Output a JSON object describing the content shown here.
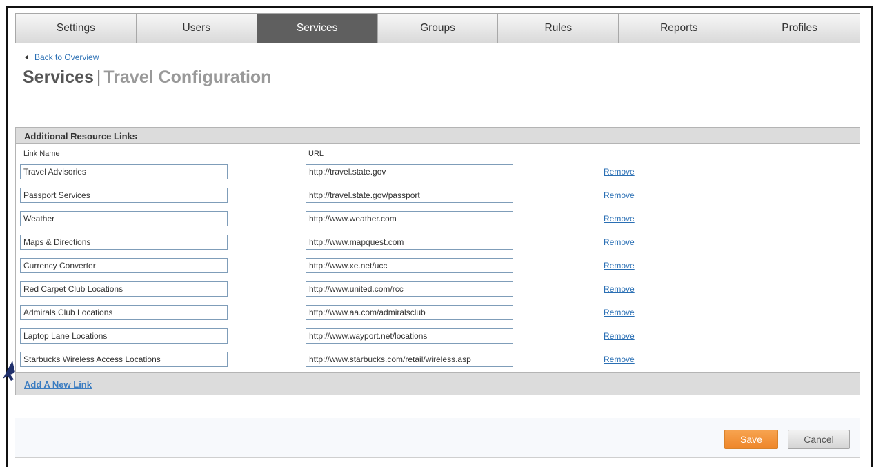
{
  "tabs": [
    {
      "label": "Settings",
      "active": false
    },
    {
      "label": "Users",
      "active": false
    },
    {
      "label": "Services",
      "active": true
    },
    {
      "label": "Groups",
      "active": false
    },
    {
      "label": "Rules",
      "active": false
    },
    {
      "label": "Reports",
      "active": false
    },
    {
      "label": "Profiles",
      "active": false
    }
  ],
  "back_link": "Back to Overview",
  "title": {
    "main": "Services",
    "separator": "|",
    "sub": "Travel Configuration"
  },
  "panel": {
    "title": "Additional Resource Links",
    "col_link_name": "Link Name",
    "col_url": "URL",
    "remove_label": "Remove",
    "add_link_label": "Add A New Link",
    "rows": [
      {
        "name": "Travel Advisories",
        "url": "http://travel.state.gov"
      },
      {
        "name": "Passport Services",
        "url": "http://travel.state.gov/passport"
      },
      {
        "name": "Weather",
        "url": "http://www.weather.com"
      },
      {
        "name": "Maps & Directions",
        "url": "http://www.mapquest.com"
      },
      {
        "name": "Currency Converter",
        "url": "http://www.xe.net/ucc"
      },
      {
        "name": "Red Carpet Club Locations",
        "url": "http://www.united.com/rcc"
      },
      {
        "name": "Admirals Club Locations",
        "url": "http://www.aa.com/admiralsclub"
      },
      {
        "name": "Laptop Lane Locations",
        "url": "http://www.wayport.net/locations"
      },
      {
        "name": "Starbucks Wireless Access Locations",
        "url": "http://www.starbucks.com/retail/wireless.asp"
      }
    ]
  },
  "actions": {
    "save_label": "Save",
    "cancel_label": "Cancel"
  },
  "colors": {
    "accent_orange": "#ee862a",
    "link_blue": "#2a6fb4",
    "active_tab": "#5f5f5f",
    "pointer_navy": "#1f2f6b"
  },
  "icons": {
    "back": "back-arrow-icon",
    "pointer": "pointer-arrow-icon"
  }
}
